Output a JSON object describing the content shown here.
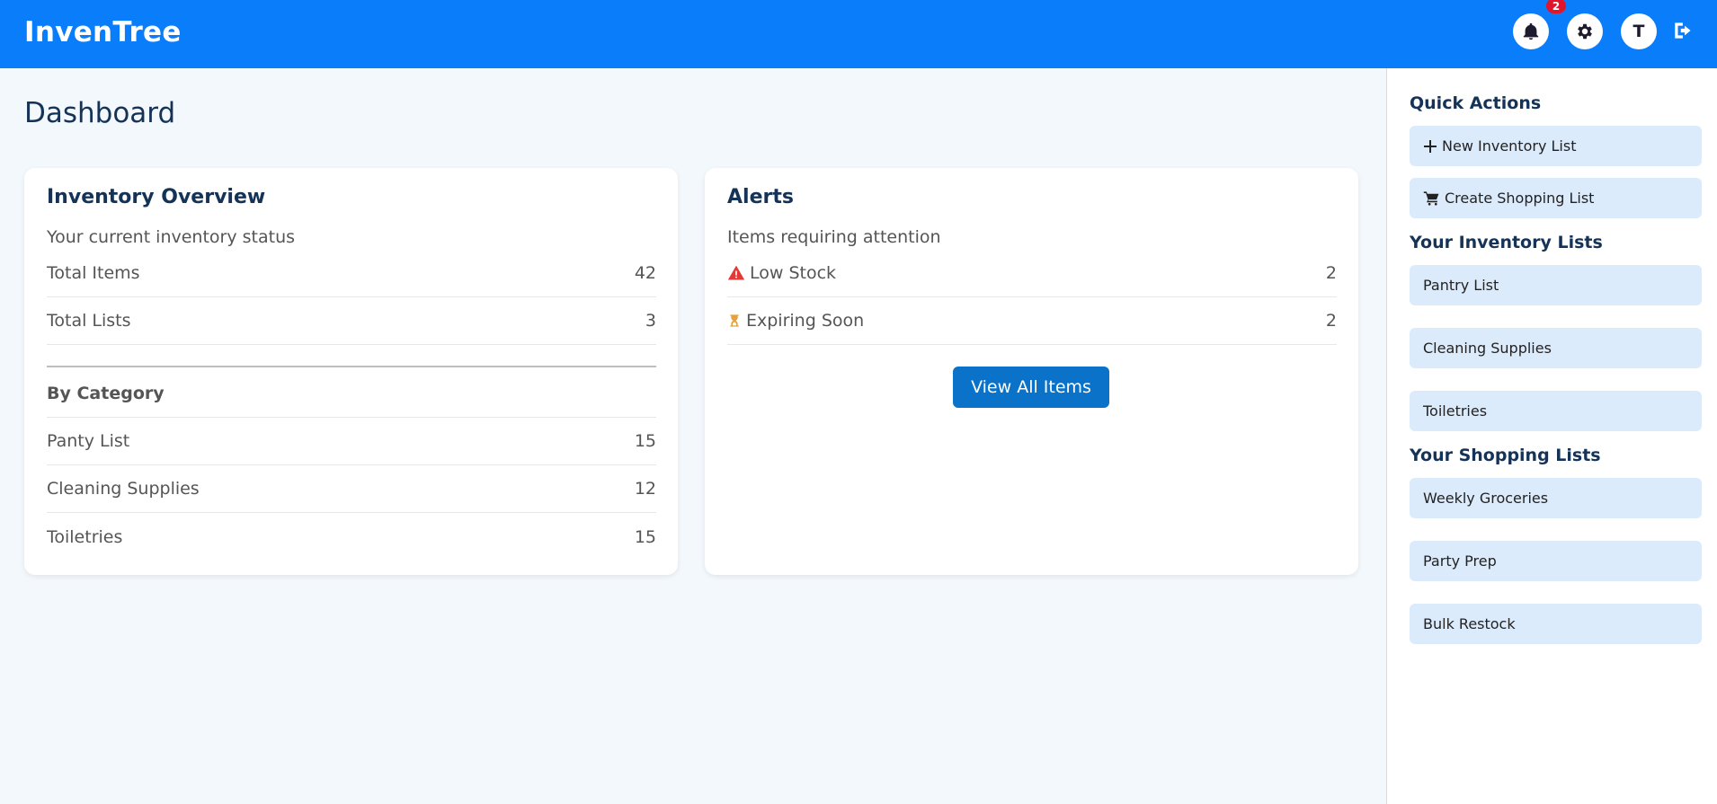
{
  "header": {
    "brand": "InvenTree",
    "notification_count": "2",
    "avatar_initial": "T"
  },
  "page": {
    "title": "Dashboard"
  },
  "overview": {
    "title": "Inventory Overview",
    "subtitle": "Your current inventory status",
    "stats": [
      {
        "label": "Total Items",
        "value": "42"
      },
      {
        "label": "Total Lists",
        "value": "3"
      }
    ],
    "category_heading": "By Category",
    "categories": [
      {
        "label": "Panty List",
        "value": "15"
      },
      {
        "label": "Cleaning Supplies",
        "value": "12"
      },
      {
        "label": "Toiletries",
        "value": "15"
      }
    ]
  },
  "alerts": {
    "title": "Alerts",
    "subtitle": "Items requiring attention",
    "items": [
      {
        "label": "Low Stock",
        "value": "2",
        "icon": "warning-icon"
      },
      {
        "label": "Expiring Soon",
        "value": "2",
        "icon": "hourglass-icon"
      }
    ],
    "button": "View All Items"
  },
  "sidebar": {
    "quick_actions_title": "Quick Actions",
    "quick_actions": [
      {
        "label": "New Inventory List",
        "icon": "plus-icon"
      },
      {
        "label": "Create Shopping List",
        "icon": "cart-icon"
      }
    ],
    "inventory_lists_title": "Your Inventory Lists",
    "inventory_lists": [
      {
        "label": "Pantry List"
      },
      {
        "label": "Cleaning Supplies"
      },
      {
        "label": "Toiletries"
      }
    ],
    "shopping_lists_title": "Your Shopping Lists",
    "shopping_lists": [
      {
        "label": "Weekly Groceries"
      },
      {
        "label": "Party Prep"
      },
      {
        "label": "Bulk Restock"
      }
    ]
  },
  "colors": {
    "header": "#0a7dfa",
    "accent_button": "#0a72c8",
    "badge": "#e0152c",
    "warning": "#e53935",
    "hourglass": "#e8a13a",
    "sidebar_item": "#dcebfb"
  }
}
